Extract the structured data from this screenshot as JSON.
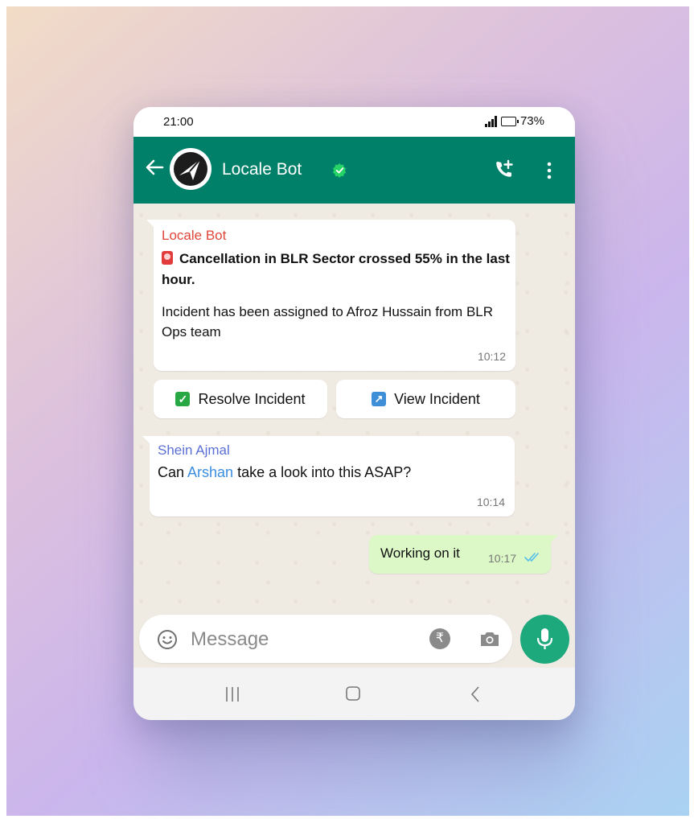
{
  "status_bar": {
    "time": "21:00",
    "battery": "73%"
  },
  "header": {
    "contact_name": "Locale Bot"
  },
  "messages": [
    {
      "sender": "Locale Bot",
      "alert": "Cancellation in BLR Sector crossed 55% in the last hour.",
      "body": "Incident has been assigned to Afroz Hussain from BLR Ops team",
      "time": "10:12"
    },
    {
      "sender": "Shein Ajmal",
      "before": "Can ",
      "mention": "Arshan",
      "after": " take a look into this ASAP?",
      "time": "10:14"
    },
    {
      "text": "Working on it",
      "time": "10:17"
    }
  ],
  "buttons": {
    "resolve": "Resolve Incident",
    "view": "View Incident"
  },
  "composer": {
    "placeholder": "Message"
  },
  "colors": {
    "header": "#008069",
    "outgoing_bubble": "#dbf8c6",
    "accent": "#1ea97c"
  }
}
